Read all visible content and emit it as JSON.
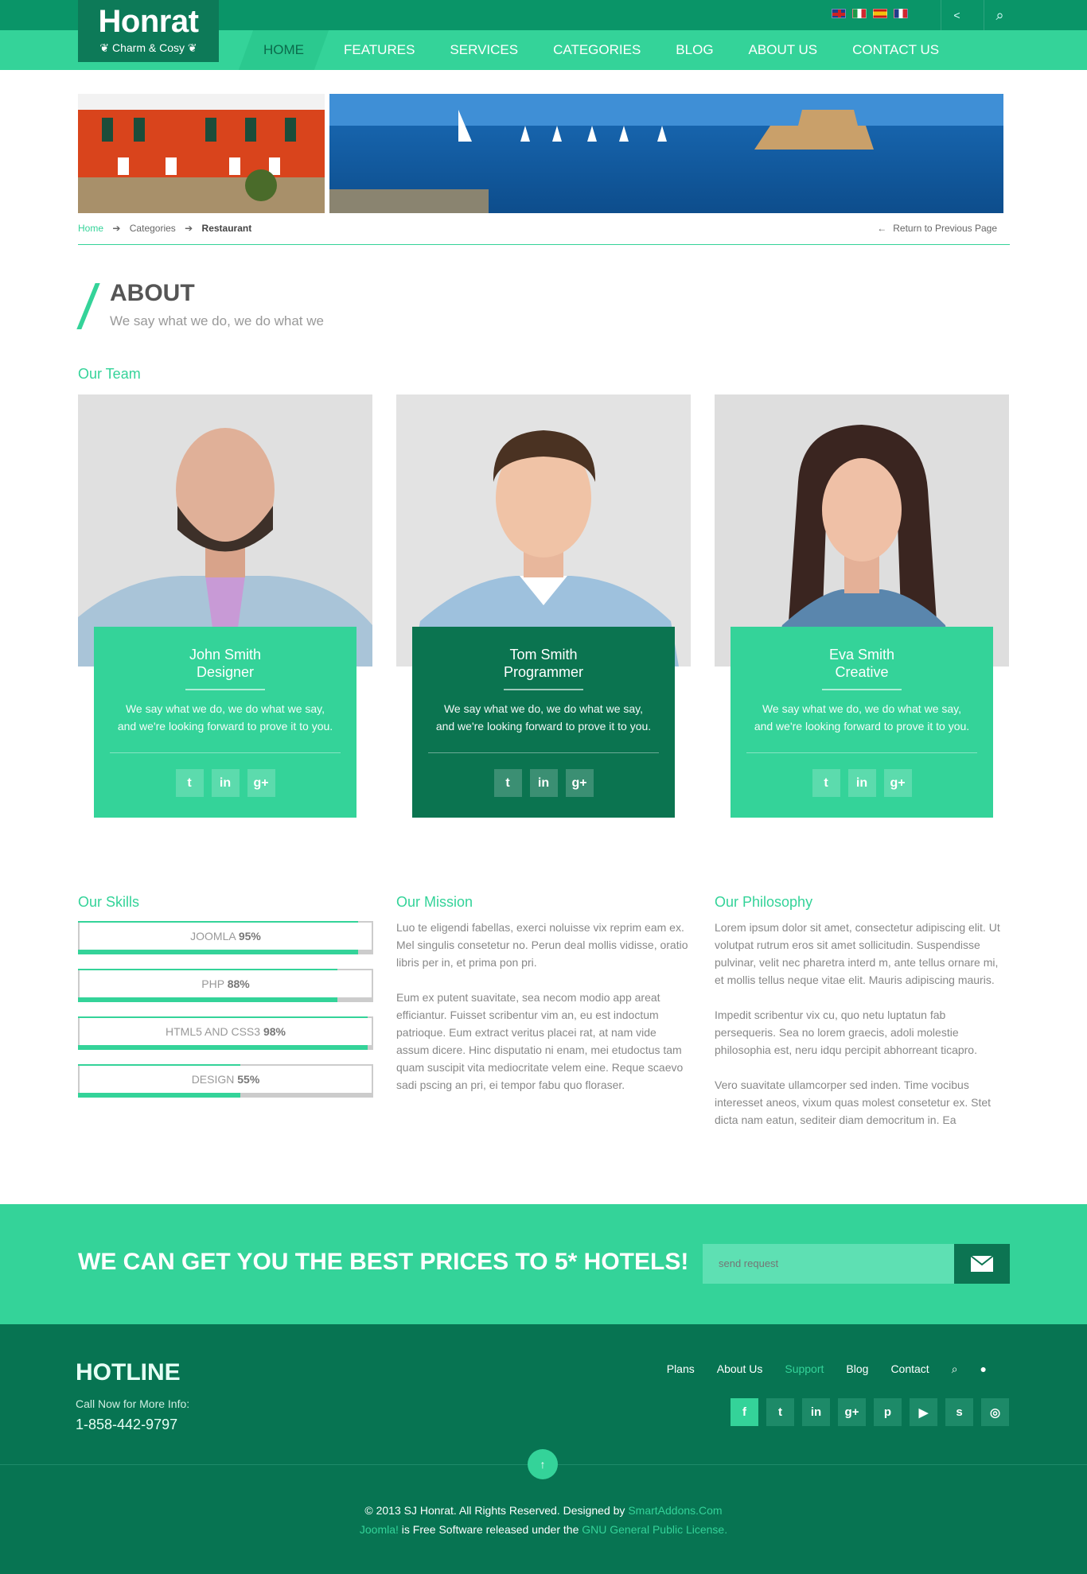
{
  "header": {
    "logo_title": "Honrat",
    "logo_sub": "❦ Charm & Cosy ❦",
    "nav": [
      "HOME",
      "FEATURES",
      "SERVICES",
      "CATEGORIES",
      "BLOG",
      "ABOUT US",
      "CONTACT US"
    ],
    "share_icon": "<",
    "search_icon": "⌕"
  },
  "breadcrumb": {
    "home": "Home",
    "mid": "Categories",
    "current": "Restaurant",
    "return": "Return to Previous Page",
    "sep": "➔",
    "ret_arrow": "←"
  },
  "about": {
    "title": "ABOUT",
    "subtitle": "We say what we do, we do what we"
  },
  "team": {
    "heading": "Our Team",
    "members": [
      {
        "name": "John Smith",
        "role": "Designer",
        "desc1": "We say what we do, we do what we say,",
        "desc2": "and we're looking forward to prove it to you."
      },
      {
        "name": "Tom Smith",
        "role": "Programmer",
        "desc1": "We say what we do, we do what we say,",
        "desc2": "and we're looking forward to prove it to you."
      },
      {
        "name": "Eva Smith",
        "role": "Creative",
        "desc1": "We say what we do, we do what we say,",
        "desc2": "and we're looking forward to prove it to you."
      }
    ],
    "social": [
      "t",
      "in",
      "g+"
    ]
  },
  "skills": {
    "heading": "Our Skills",
    "items": [
      {
        "name": "JOOMLA",
        "pct": "95%",
        "value": 95
      },
      {
        "name": "PHP",
        "pct": "88%",
        "value": 88
      },
      {
        "name": "HTML5 AND CSS3",
        "pct": "98%",
        "value": 98
      },
      {
        "name": "DESIGN",
        "pct": "55%",
        "value": 55
      }
    ]
  },
  "mission": {
    "heading": "Our Mission",
    "p1": "Luo te eligendi fabellas, exerci noluisse vix reprim eam ex. Mel singulis consetetur no. Perun deal mollis vidisse, oratio libris per in, et prima pon pri.",
    "p2": "Eum ex putent suavitate, sea necom modio app areat efficiantur. Fuisset scribentur vim an, eu est indoctum patrioque. Eum extract veritus placei rat, at nam vide assum dicere. Hinc disputatio ni enam, mei etudoctus tam quam suscipit vita mediocritate velem eine. Reque scaevo sadi pscing an pri, ei tempor fabu quo floraser."
  },
  "philosophy": {
    "heading": "Our Philosophy",
    "p1": "Lorem ipsum dolor sit amet, consectetur adipiscing elit. Ut volutpat rutrum eros sit amet sollicitudin. Suspendisse pulvinar, velit nec pharetra interd m, ante tellus ornare mi, et mollis tellus neque vitae elit. Mauris adipiscing mauris.",
    "p2": "Impedit scribentur vix cu, quo netu luptatun fab persequeris. Sea no lorem graecis, adoli molestie philosophia est, neru idqu percipit abhorreant ticapro.",
    "p3": "Vero suavitate ullamcorper sed inden. Time vocibus interesset aneos, vixum quas molest consetetur ex. Stet dicta nam eatun, sediteir diam democritum in. Ea"
  },
  "cta": {
    "title": "WE CAN GET YOU THE BEST PRICES TO 5* HOTELS!",
    "placeholder": "send request"
  },
  "footer": {
    "hotline": "HOTLINE",
    "call": "Call Now for More Info:",
    "phone": "1-858-442-9797",
    "links": [
      "Plans",
      "About Us",
      "Support",
      "Blog",
      "Contact"
    ],
    "search_icon": "⌕",
    "user_icon": "●",
    "social": [
      "f",
      "t",
      "in",
      "g+",
      "p",
      "▶",
      "s",
      "◎"
    ],
    "up": "↑",
    "copy1": "© 2013 SJ Honrat. All Rights Reserved. Designed by ",
    "copy1_link": "SmartAddons.Com",
    "copy2_link1": "Joomla!",
    "copy2_mid": " is Free Software released under the ",
    "copy2_link2": "GNU General Public License."
  }
}
